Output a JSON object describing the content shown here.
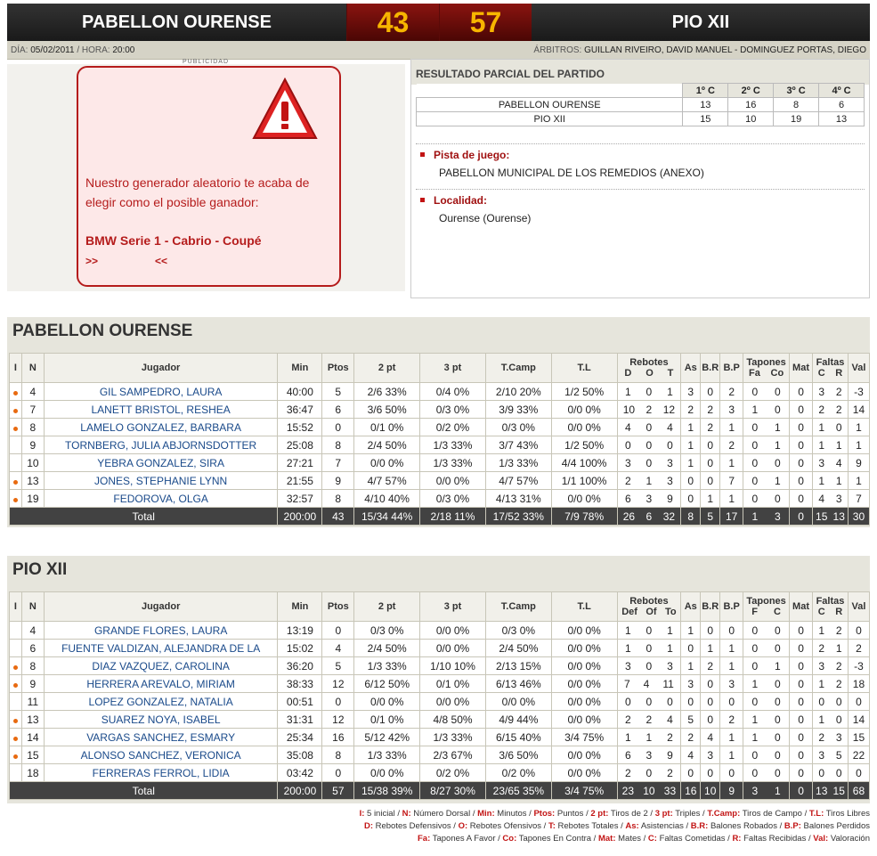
{
  "header": {
    "home": "PABELLON OURENSE",
    "home_score": "43",
    "away_score": "57",
    "away": "PIO XII"
  },
  "info": {
    "date_label": "DÍA:",
    "date": "05/02/2011",
    "time_label": "/ HORA:",
    "time": "20:00",
    "referees_label": "ÁRBITROS:",
    "referees": "GUILLAN RIVEIRO, DAVID MANUEL - DOMINGUEZ PORTAS, DIEGO"
  },
  "ad": {
    "publicidad": "PUBLICIDAD",
    "message": "Nuestro generador aleatorio te acaba de elegir como el posible ganador:",
    "prize": "BMW Serie 1 - Cabrio - Coupé",
    "arrow_left": ">>",
    "arrow_right": "<<"
  },
  "partial": {
    "title": "RESULTADO PARCIAL DEL PARTIDO",
    "quarters": [
      "1º C",
      "2º C",
      "3º C",
      "4º C"
    ],
    "rows": [
      {
        "team": "PABELLON OURENSE",
        "q": [
          "13",
          "16",
          "8",
          "6"
        ]
      },
      {
        "team": "PIO XII",
        "q": [
          "15",
          "10",
          "19",
          "13"
        ]
      }
    ],
    "venue_label": "Pista de juego:",
    "venue": "PABELLON MUNICIPAL DE LOS REMEDIOS (ANEXO)",
    "locality_label": "Localidad:",
    "locality": "Ourense (Ourense)"
  },
  "teams": [
    {
      "title": "PABELLON OURENSE",
      "headers": {
        "i": "I",
        "n": "N",
        "player": "Jugador",
        "min": "Min",
        "pts": "Ptos",
        "p2": "2 pt",
        "p3": "3 pt",
        "tc": "T.Camp",
        "tl": "T.L",
        "reb": "Rebotes",
        "reb_sub": [
          "D",
          "O",
          "T"
        ],
        "as": "As",
        "br": "B.R",
        "bp": "B.P",
        "tap": "Tapones",
        "tap_sub": [
          "Fa",
          "Co"
        ],
        "mat": "Mat",
        "faltas": "Faltas",
        "faltas_sub": [
          "C",
          "R"
        ],
        "val": "Val"
      },
      "players": [
        {
          "starter": true,
          "n": "4",
          "name": "GIL SAMPEDRO, LAURA",
          "min": "40:00",
          "pts": "5",
          "p2": "2/6 33%",
          "p3": "0/4 0%",
          "tc": "2/10 20%",
          "tl": "1/2 50%",
          "d": "1",
          "o": "0",
          "t": "1",
          "as": "3",
          "br": "0",
          "bp": "2",
          "fa": "0",
          "co": "0",
          "mat": "0",
          "fc": "3",
          "fr": "2",
          "val": "-3"
        },
        {
          "starter": true,
          "n": "7",
          "name": "LANETT BRISTOL, RESHEA",
          "min": "36:47",
          "pts": "6",
          "p2": "3/6 50%",
          "p3": "0/3 0%",
          "tc": "3/9 33%",
          "tl": "0/0 0%",
          "d": "10",
          "o": "2",
          "t": "12",
          "as": "2",
          "br": "2",
          "bp": "3",
          "fa": "1",
          "co": "0",
          "mat": "0",
          "fc": "2",
          "fr": "2",
          "val": "14"
        },
        {
          "starter": true,
          "n": "8",
          "name": "LAMELO GONZALEZ, BARBARA",
          "min": "15:52",
          "pts": "0",
          "p2": "0/1 0%",
          "p3": "0/2 0%",
          "tc": "0/3 0%",
          "tl": "0/0 0%",
          "d": "4",
          "o": "0",
          "t": "4",
          "as": "1",
          "br": "2",
          "bp": "1",
          "fa": "0",
          "co": "1",
          "mat": "0",
          "fc": "1",
          "fr": "0",
          "val": "1"
        },
        {
          "starter": false,
          "n": "9",
          "name": "TORNBERG, JULIA ABJORNSDOTTER",
          "min": "25:08",
          "pts": "8",
          "p2": "2/4 50%",
          "p3": "1/3 33%",
          "tc": "3/7 43%",
          "tl": "1/2 50%",
          "d": "0",
          "o": "0",
          "t": "0",
          "as": "1",
          "br": "0",
          "bp": "2",
          "fa": "0",
          "co": "1",
          "mat": "0",
          "fc": "1",
          "fr": "1",
          "val": "1"
        },
        {
          "starter": false,
          "n": "10",
          "name": "YEBRA GONZALEZ, SIRA",
          "min": "27:21",
          "pts": "7",
          "p2": "0/0 0%",
          "p3": "1/3 33%",
          "tc": "1/3 33%",
          "tl": "4/4 100%",
          "d": "3",
          "o": "0",
          "t": "3",
          "as": "1",
          "br": "0",
          "bp": "1",
          "fa": "0",
          "co": "0",
          "mat": "0",
          "fc": "3",
          "fr": "4",
          "val": "9"
        },
        {
          "starter": true,
          "n": "13",
          "name": "JONES, STEPHANIE LYNN",
          "min": "21:55",
          "pts": "9",
          "p2": "4/7 57%",
          "p3": "0/0 0%",
          "tc": "4/7 57%",
          "tl": "1/1 100%",
          "d": "2",
          "o": "1",
          "t": "3",
          "as": "0",
          "br": "0",
          "bp": "7",
          "fa": "0",
          "co": "1",
          "mat": "0",
          "fc": "1",
          "fr": "1",
          "val": "1"
        },
        {
          "starter": true,
          "n": "19",
          "name": "FEDOROVA, OLGA",
          "min": "32:57",
          "pts": "8",
          "p2": "4/10 40%",
          "p3": "0/3 0%",
          "tc": "4/13 31%",
          "tl": "0/0 0%",
          "d": "6",
          "o": "3",
          "t": "9",
          "as": "0",
          "br": "1",
          "bp": "1",
          "fa": "0",
          "co": "0",
          "mat": "0",
          "fc": "4",
          "fr": "3",
          "val": "7"
        }
      ],
      "total": {
        "label": "Total",
        "min": "200:00",
        "pts": "43",
        "p2": "15/34 44%",
        "p3": "2/18 11%",
        "tc": "17/52 33%",
        "tl": "7/9 78%",
        "d": "26",
        "o": "6",
        "t": "32",
        "as": "8",
        "br": "5",
        "bp": "17",
        "fa": "1",
        "co": "3",
        "mat": "0",
        "fc": "15",
        "fr": "13",
        "val": "30"
      }
    },
    {
      "title": "PIO XII",
      "headers": {
        "i": "I",
        "n": "N",
        "player": "Jugador",
        "min": "Min",
        "pts": "Ptos",
        "p2": "2 pt",
        "p3": "3 pt",
        "tc": "T.Camp",
        "tl": "T.L",
        "reb": "Rebotes",
        "reb_sub": [
          "Def",
          "Of",
          "To"
        ],
        "as": "As",
        "br": "B.R",
        "bp": "B.P",
        "tap": "Tapones",
        "tap_sub": [
          "F",
          "C"
        ],
        "mat": "Mat",
        "faltas": "Faltas",
        "faltas_sub": [
          "C",
          "R"
        ],
        "val": "Val"
      },
      "players": [
        {
          "starter": false,
          "n": "4",
          "name": "GRANDE FLORES, LAURA",
          "min": "13:19",
          "pts": "0",
          "p2": "0/3 0%",
          "p3": "0/0 0%",
          "tc": "0/3 0%",
          "tl": "0/0 0%",
          "d": "1",
          "o": "0",
          "t": "1",
          "as": "1",
          "br": "0",
          "bp": "0",
          "fa": "0",
          "co": "0",
          "mat": "0",
          "fc": "1",
          "fr": "2",
          "val": "0"
        },
        {
          "starter": false,
          "n": "6",
          "name": "FUENTE VALDIZAN, ALEJANDRA DE LA",
          "min": "15:02",
          "pts": "4",
          "p2": "2/4 50%",
          "p3": "0/0 0%",
          "tc": "2/4 50%",
          "tl": "0/0 0%",
          "d": "1",
          "o": "0",
          "t": "1",
          "as": "0",
          "br": "1",
          "bp": "1",
          "fa": "0",
          "co": "0",
          "mat": "0",
          "fc": "2",
          "fr": "1",
          "val": "2"
        },
        {
          "starter": true,
          "n": "8",
          "name": "DIAZ VAZQUEZ, CAROLINA",
          "min": "36:20",
          "pts": "5",
          "p2": "1/3 33%",
          "p3": "1/10 10%",
          "tc": "2/13 15%",
          "tl": "0/0 0%",
          "d": "3",
          "o": "0",
          "t": "3",
          "as": "1",
          "br": "2",
          "bp": "1",
          "fa": "0",
          "co": "1",
          "mat": "0",
          "fc": "3",
          "fr": "2",
          "val": "-3"
        },
        {
          "starter": true,
          "n": "9",
          "name": "HERRERA AREVALO, MIRIAM",
          "min": "38:33",
          "pts": "12",
          "p2": "6/12 50%",
          "p3": "0/1 0%",
          "tc": "6/13 46%",
          "tl": "0/0 0%",
          "d": "7",
          "o": "4",
          "t": "11",
          "as": "3",
          "br": "0",
          "bp": "3",
          "fa": "1",
          "co": "0",
          "mat": "0",
          "fc": "1",
          "fr": "2",
          "val": "18"
        },
        {
          "starter": false,
          "n": "11",
          "name": "LOPEZ GONZALEZ, NATALIA",
          "min": "00:51",
          "pts": "0",
          "p2": "0/0 0%",
          "p3": "0/0 0%",
          "tc": "0/0 0%",
          "tl": "0/0 0%",
          "d": "0",
          "o": "0",
          "t": "0",
          "as": "0",
          "br": "0",
          "bp": "0",
          "fa": "0",
          "co": "0",
          "mat": "0",
          "fc": "0",
          "fr": "0",
          "val": "0"
        },
        {
          "starter": true,
          "n": "13",
          "name": "SUAREZ NOYA, ISABEL",
          "min": "31:31",
          "pts": "12",
          "p2": "0/1 0%",
          "p3": "4/8 50%",
          "tc": "4/9 44%",
          "tl": "0/0 0%",
          "d": "2",
          "o": "2",
          "t": "4",
          "as": "5",
          "br": "0",
          "bp": "2",
          "fa": "1",
          "co": "0",
          "mat": "0",
          "fc": "1",
          "fr": "0",
          "val": "14"
        },
        {
          "starter": true,
          "n": "14",
          "name": "VARGAS SANCHEZ, ESMARY",
          "min": "25:34",
          "pts": "16",
          "p2": "5/12 42%",
          "p3": "1/3 33%",
          "tc": "6/15 40%",
          "tl": "3/4 75%",
          "d": "1",
          "o": "1",
          "t": "2",
          "as": "2",
          "br": "4",
          "bp": "1",
          "fa": "1",
          "co": "0",
          "mat": "0",
          "fc": "2",
          "fr": "3",
          "val": "15"
        },
        {
          "starter": true,
          "n": "15",
          "name": "ALONSO SANCHEZ, VERONICA",
          "min": "35:08",
          "pts": "8",
          "p2": "1/3 33%",
          "p3": "2/3 67%",
          "tc": "3/6 50%",
          "tl": "0/0 0%",
          "d": "6",
          "o": "3",
          "t": "9",
          "as": "4",
          "br": "3",
          "bp": "1",
          "fa": "0",
          "co": "0",
          "mat": "0",
          "fc": "3",
          "fr": "5",
          "val": "22"
        },
        {
          "starter": false,
          "n": "18",
          "name": "FERRERAS FERROL, LIDIA",
          "min": "03:42",
          "pts": "0",
          "p2": "0/0 0%",
          "p3": "0/2 0%",
          "tc": "0/2 0%",
          "tl": "0/0 0%",
          "d": "2",
          "o": "0",
          "t": "2",
          "as": "0",
          "br": "0",
          "bp": "0",
          "fa": "0",
          "co": "0",
          "mat": "0",
          "fc": "0",
          "fr": "0",
          "val": "0"
        }
      ],
      "total": {
        "label": "Total",
        "min": "200:00",
        "pts": "57",
        "p2": "15/38 39%",
        "p3": "8/27 30%",
        "tc": "23/65 35%",
        "tl": "3/4 75%",
        "d": "23",
        "o": "10",
        "t": "33",
        "as": "16",
        "br": "10",
        "bp": "9",
        "fa": "3",
        "co": "1",
        "mat": "0",
        "fc": "13",
        "fr": "15",
        "val": "68"
      }
    }
  ],
  "legend": [
    [
      [
        "I:",
        "5 inicial /"
      ],
      [
        "N:",
        "Número Dorsal /"
      ],
      [
        "Min:",
        "Minutos /"
      ],
      [
        "Ptos:",
        "Puntos /"
      ],
      [
        "2 pt:",
        "Tiros de 2 /"
      ],
      [
        "3 pt:",
        "Triples /"
      ],
      [
        "T.Camp:",
        "Tiros de Campo /"
      ],
      [
        "T.L:",
        "Tiros Libres"
      ]
    ],
    [
      [
        "D:",
        "Rebotes Defensivos /"
      ],
      [
        "O:",
        "Rebotes Ofensivos /"
      ],
      [
        "T:",
        "Rebotes Totales /"
      ],
      [
        "As:",
        "Asistencias /"
      ],
      [
        "B.R:",
        "Balones Robados /"
      ],
      [
        "B.P:",
        "Balones Perdidos"
      ]
    ],
    [
      [
        "Fa:",
        "Tapones A Favor /"
      ],
      [
        "Co:",
        "Tapones En Contra /"
      ],
      [
        "Mat:",
        "Mates /"
      ],
      [
        "C:",
        "Faltas Cometidas /"
      ],
      [
        "R:",
        "Faltas Recibidas /"
      ],
      [
        "Val:",
        "Valoración"
      ]
    ]
  ],
  "colors": {
    "accent": "#c21414",
    "score_text": "#f7b500",
    "starter_dot": "#e86a10",
    "link": "#1a4a8a"
  }
}
